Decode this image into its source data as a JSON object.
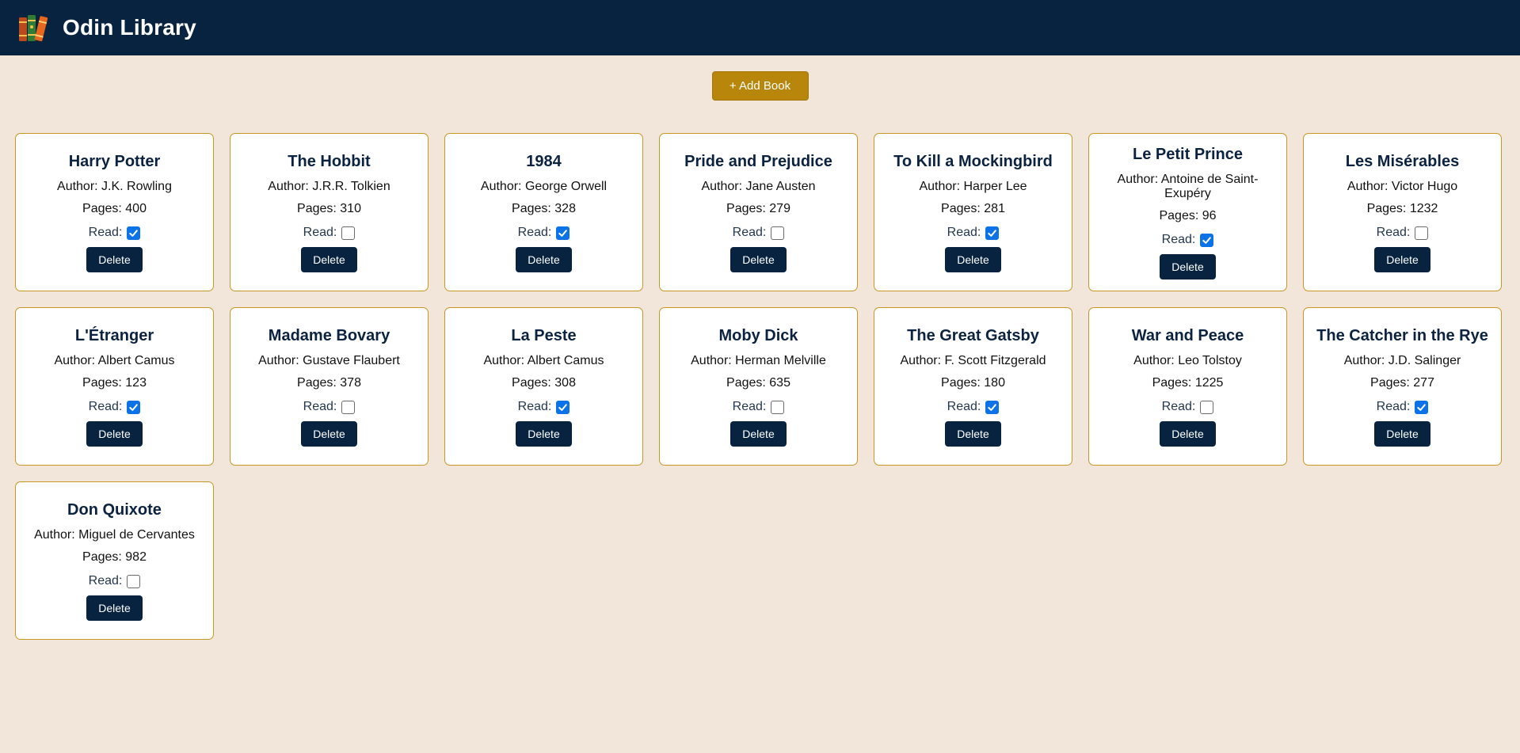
{
  "header": {
    "title": "Odin Library",
    "logo_icon": "books-icon"
  },
  "toolbar": {
    "add_label": "+ Add Book",
    "accent": "#b8860b"
  },
  "labels": {
    "author_prefix": "Author: ",
    "pages_prefix": "Pages: ",
    "read": "Read:",
    "delete": "Delete"
  },
  "colors": {
    "navy": "#072340",
    "background": "#f1e6d9",
    "card_border": "#c99722",
    "checkbox": "#0b72e7"
  },
  "books": [
    {
      "title": "Harry Potter",
      "author": "J.K. Rowling",
      "pages": "400",
      "read": true
    },
    {
      "title": "The Hobbit",
      "author": "J.R.R. Tolkien",
      "pages": "310",
      "read": false
    },
    {
      "title": "1984",
      "author": "George Orwell",
      "pages": "328",
      "read": true
    },
    {
      "title": "Pride and Prejudice",
      "author": "Jane Austen",
      "pages": "279",
      "read": false
    },
    {
      "title": "To Kill a Mockingbird",
      "author": "Harper Lee",
      "pages": "281",
      "read": true
    },
    {
      "title": "Le Petit Prince",
      "author": "Antoine de Saint-Exupéry",
      "pages": "96",
      "read": true
    },
    {
      "title": "Les Misérables",
      "author": "Victor Hugo",
      "pages": "1232",
      "read": false
    },
    {
      "title": "L'Étranger",
      "author": "Albert Camus",
      "pages": "123",
      "read": true
    },
    {
      "title": "Madame Bovary",
      "author": "Gustave Flaubert",
      "pages": "378",
      "read": false
    },
    {
      "title": "La Peste",
      "author": "Albert Camus",
      "pages": "308",
      "read": true
    },
    {
      "title": "Moby Dick",
      "author": "Herman Melville",
      "pages": "635",
      "read": false
    },
    {
      "title": "The Great Gatsby",
      "author": "F. Scott Fitzgerald",
      "pages": "180",
      "read": true
    },
    {
      "title": "War and Peace",
      "author": "Leo Tolstoy",
      "pages": "1225",
      "read": false
    },
    {
      "title": "The Catcher in the Rye",
      "author": "J.D. Salinger",
      "pages": "277",
      "read": true
    },
    {
      "title": "Don Quixote",
      "author": "Miguel de Cervantes",
      "pages": "982",
      "read": false
    }
  ]
}
